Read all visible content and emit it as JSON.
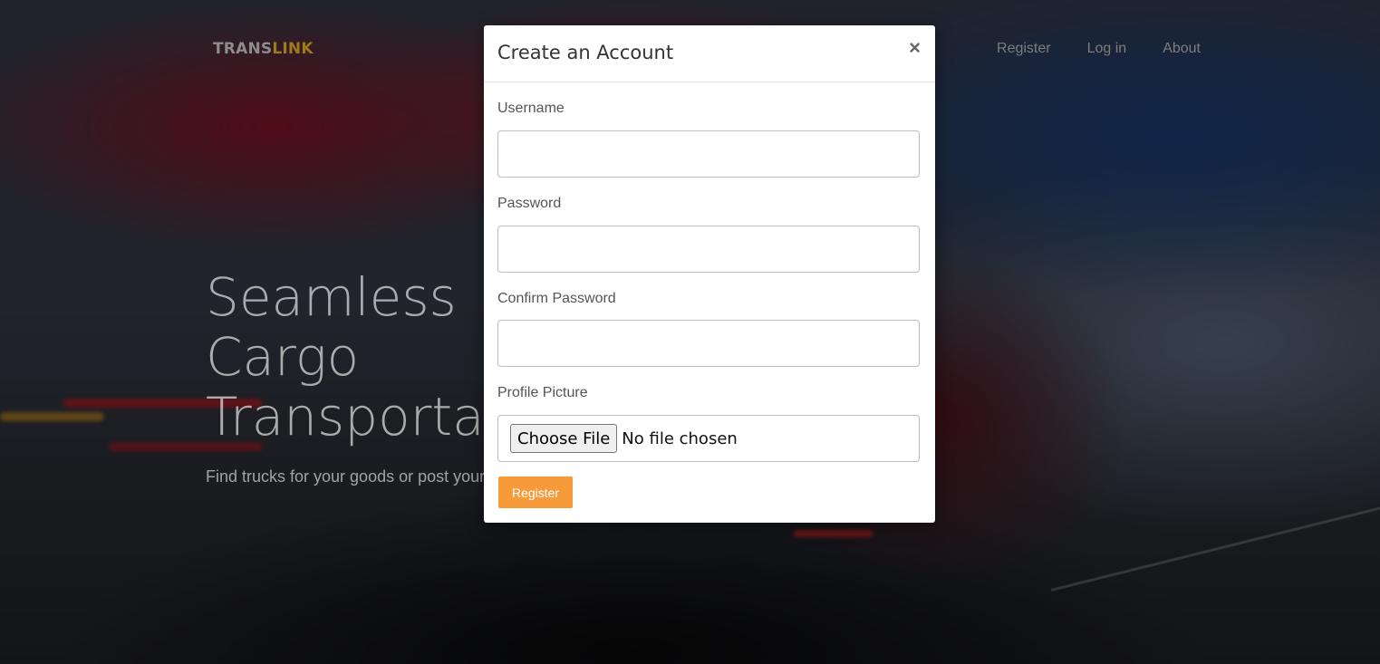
{
  "navbar": {
    "brand_part1": "TRANS",
    "brand_part2": "LINK",
    "links": [
      "Register",
      "Log in",
      "About"
    ]
  },
  "hero": {
    "title_lines": [
      "Seamless",
      "Cargo",
      "Transportation"
    ],
    "subtitle": "Find trucks for your goods or post your"
  },
  "modal": {
    "title": "Create an Account",
    "close_glyph": "×",
    "username_label": "Username",
    "password_label": "Password",
    "confirm_password_label": "Confirm Password",
    "profile_picture_label": "Profile Picture",
    "choose_file_label": "Choose File",
    "no_file_text": "No file chosen",
    "register_button": "Register"
  },
  "colors": {
    "accent": "#f79a3a",
    "brand_gold": "#a07a1a"
  }
}
